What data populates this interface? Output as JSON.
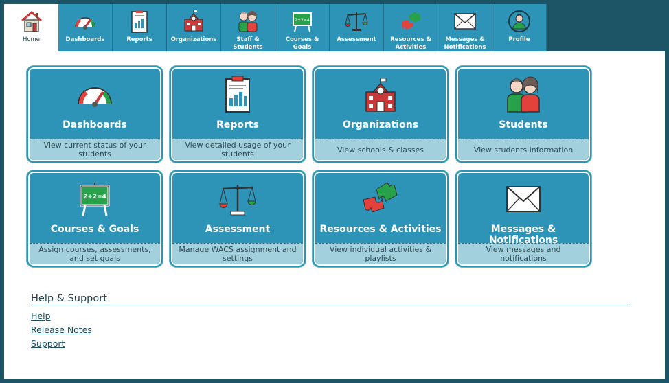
{
  "nav": {
    "tabs": [
      {
        "label": "Home",
        "icon": "home-icon",
        "active": true
      },
      {
        "label": "Dashboards",
        "icon": "gauge-icon"
      },
      {
        "label": "Reports",
        "icon": "report-icon"
      },
      {
        "label": "Organizations",
        "icon": "school-icon"
      },
      {
        "label": "Staff & Students",
        "icon": "people-icon"
      },
      {
        "label": "Courses & Goals",
        "icon": "chalkboard-icon"
      },
      {
        "label": "Assessment",
        "icon": "scales-icon"
      },
      {
        "label": "Resources &\nActivities",
        "icon": "puzzle-icon"
      },
      {
        "label": "Messages &\nNotifications",
        "icon": "envelope-icon"
      },
      {
        "label": "Profile",
        "icon": "profile-icon"
      }
    ]
  },
  "cards": [
    {
      "title": "Dashboards",
      "desc": "View current status of your students",
      "icon": "gauge-icon"
    },
    {
      "title": "Reports",
      "desc": "View detailed usage of your students",
      "icon": "report-icon"
    },
    {
      "title": "Organizations",
      "desc": "View schools & classes",
      "icon": "school-icon"
    },
    {
      "title": "Students",
      "desc": "View students information",
      "icon": "people-icon"
    },
    {
      "title": "Courses & Goals",
      "desc": "Assign courses, assessments, and set goals",
      "icon": "chalkboard-icon"
    },
    {
      "title": "Assessment",
      "desc": "Manage WACS assignment and settings",
      "icon": "scales-icon"
    },
    {
      "title": "Resources & Activities",
      "desc": "View individual activities & playlists",
      "icon": "puzzle-icon"
    },
    {
      "title": "Messages & Notifications",
      "desc": "View messages and notifications",
      "icon": "envelope-icon"
    }
  ],
  "help": {
    "heading": "Help & Support",
    "links": [
      "Help",
      "Release Notes",
      "Support"
    ]
  },
  "chalkboard_text": "2+2=4",
  "colors": {
    "primary": "#2e94b7",
    "desc_bg": "#a3d0dd",
    "frame": "#1e5566",
    "red": "#e3413c",
    "green": "#27a24b"
  }
}
